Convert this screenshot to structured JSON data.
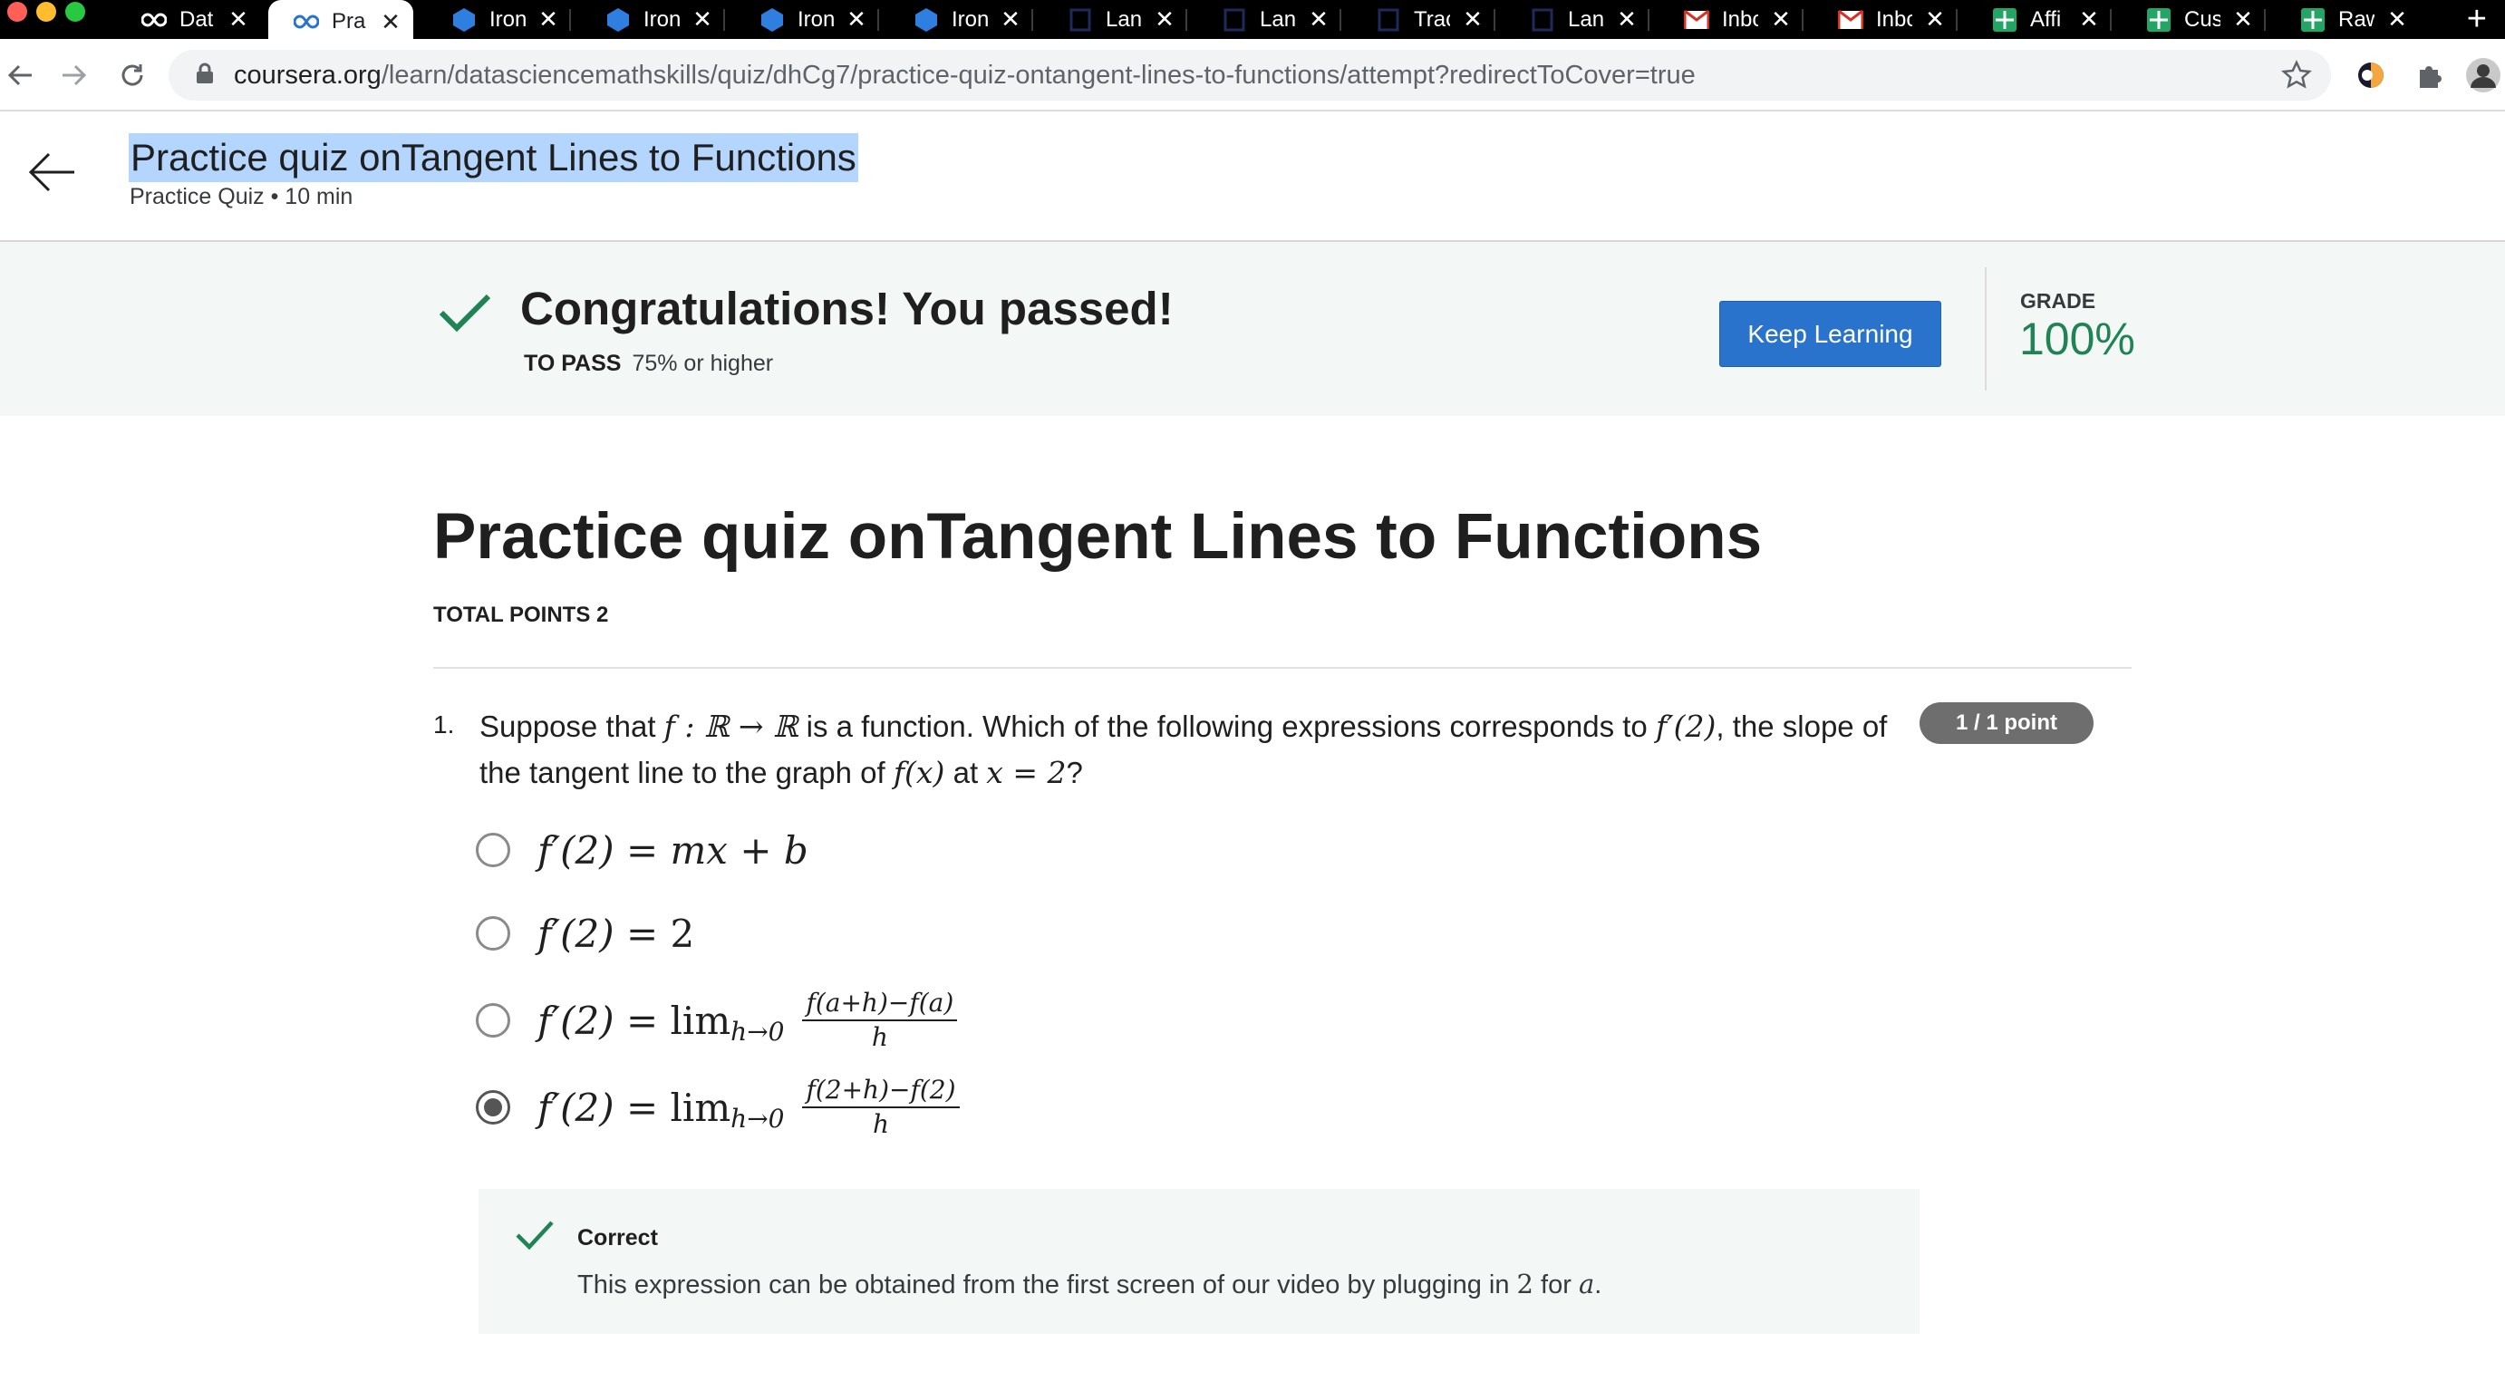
{
  "browser": {
    "tabs": [
      {
        "label": "Dat",
        "icon": "coursera-icon",
        "active": false
      },
      {
        "label": "Pra",
        "icon": "coursera-icon",
        "active": true
      },
      {
        "label": "Iron",
        "icon": "ironhack-icon",
        "active": false
      },
      {
        "label": "Iron",
        "icon": "ironhack-icon",
        "active": false
      },
      {
        "label": "Iron",
        "icon": "ironhack-icon",
        "active": false
      },
      {
        "label": "Iron",
        "icon": "ironhack-icon",
        "active": false
      },
      {
        "label": "Lan",
        "icon": "doc-icon",
        "active": false
      },
      {
        "label": "Lan",
        "icon": "doc-icon",
        "active": false
      },
      {
        "label": "Trac",
        "icon": "doc-icon",
        "active": false
      },
      {
        "label": "Lan",
        "icon": "doc-icon",
        "active": false
      },
      {
        "label": "Inbo",
        "icon": "gmail-icon",
        "active": false
      },
      {
        "label": "Inbo",
        "icon": "gmail-icon",
        "active": false
      },
      {
        "label": "Affi",
        "icon": "sheets-icon",
        "active": false
      },
      {
        "label": "Cus",
        "icon": "sheets-icon",
        "active": false
      },
      {
        "label": "Raw",
        "icon": "sheets-icon",
        "active": false
      }
    ],
    "tab_close_glyph": "✕",
    "new_tab_glyph": "+",
    "url_host": "coursera.org",
    "url_path": "/learn/datasciencemathskills/quiz/dhCg7/practice-quiz-ontangent-lines-to-functions/attempt?redirectToCover=true"
  },
  "header": {
    "title": "Practice quiz onTangent Lines to Functions",
    "subtitle": "Practice Quiz • 10 min"
  },
  "banner": {
    "message": "Congratulations! You passed!",
    "to_pass_label": "TO PASS",
    "to_pass_value": "75% or higher",
    "keep_learning": "Keep Learning",
    "grade_label": "GRADE",
    "grade_value": "100%"
  },
  "quiz": {
    "title": "Practice quiz onTangent Lines to Functions",
    "total_points": "TOTAL POINTS 2",
    "question": {
      "number": "1.",
      "points": "1 / 1 point",
      "text_a": "Suppose that ",
      "math_fn": "f : ℝ → ℝ",
      "text_b": " is a function. Which of the following expressions corresponds to ",
      "math_deriv": "f′(2)",
      "text_c": ", the slope of the tangent line to the graph of ",
      "math_fx": "f(x)",
      "text_d": " at ",
      "math_x": "x = 2",
      "text_e": "?",
      "options": [
        {
          "lhs": "f′(2)",
          "rhs": "= mx + b",
          "checked": false
        },
        {
          "lhs": "f′(2)",
          "rhs": "= 2",
          "checked": false
        },
        {
          "lhs": "f′(2)",
          "rhs": "= lim",
          "sub": "h→0",
          "num": "f(a+h)−f(a)",
          "den": "h",
          "checked": false
        },
        {
          "lhs": "f′(2)",
          "rhs": "= lim",
          "sub": "h→0",
          "num": "f(2+h)−f(2)",
          "den": "h",
          "checked": true
        }
      ]
    },
    "feedback": {
      "status": "Correct",
      "text_a": "This expression can be obtained from the first screen of our video by plugging in ",
      "math_2": "2",
      "text_b": " for ",
      "math_a": "a",
      "text_c": "."
    }
  },
  "colors": {
    "accent_blue": "#2a73cc",
    "success_green": "#1f8354",
    "banner_bg": "#f3f8f6",
    "selection_highlight": "#b4d5fe"
  }
}
